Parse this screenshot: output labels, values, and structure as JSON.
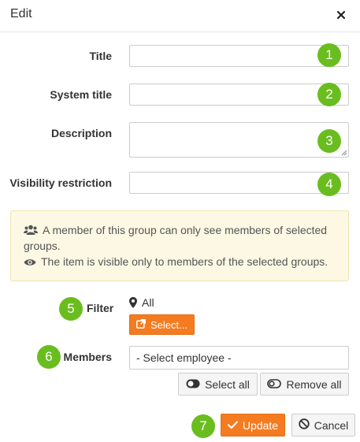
{
  "dialog": {
    "title": "Edit",
    "close_icon": "close-icon"
  },
  "form": {
    "title_label": "Title",
    "title_value": "",
    "system_title_label": "System title",
    "system_title_value": "",
    "description_label": "Description",
    "description_value": "",
    "visibility_label": "Visibility restriction",
    "visibility_value": ""
  },
  "badges": [
    "1",
    "2",
    "3",
    "4",
    "5",
    "6",
    "7"
  ],
  "info": {
    "line1": "A member of this group can only see members of selected groups.",
    "line2": "The item is visible only to members of the selected groups.",
    "line1_icon": "users-icon",
    "line2_icon": "eye-icon"
  },
  "filter": {
    "label": "Filter",
    "value": "All",
    "value_icon": "map-marker-icon",
    "select_button": "Select...",
    "select_icon": "external-link-icon"
  },
  "members": {
    "label": "Members",
    "placeholder": "- Select employee -",
    "select_all": "Select all",
    "remove_all": "Remove all"
  },
  "actions": {
    "update": "Update",
    "cancel": "Cancel"
  },
  "colors": {
    "accent": "#f47b20",
    "badge": "#6abd1e",
    "info_bg": "#fcf8e3"
  }
}
